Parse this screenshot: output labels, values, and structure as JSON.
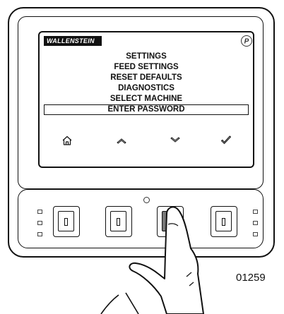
{
  "brand": {
    "name": "WALLENSTEIN"
  },
  "badge": {
    "letter": "P",
    "icon": "pause-p-icon"
  },
  "menu": {
    "items": [
      {
        "label": "SETTINGS",
        "selected": false
      },
      {
        "label": "FEED SETTINGS",
        "selected": false
      },
      {
        "label": "RESET DEFAULTS",
        "selected": false
      },
      {
        "label": "DIAGNOSTICS",
        "selected": false
      },
      {
        "label": "SELECT MACHINE",
        "selected": false
      },
      {
        "label": "ENTER PASSWORD",
        "selected": true
      }
    ]
  },
  "softkeys": [
    {
      "icon": "home-icon"
    },
    {
      "icon": "chevron-up-icon"
    },
    {
      "icon": "chevron-down-icon"
    },
    {
      "icon": "checkmark-icon"
    }
  ],
  "hardware_buttons": [
    {
      "name": "button-1",
      "pressed": false
    },
    {
      "name": "button-2",
      "pressed": false
    },
    {
      "name": "button-3",
      "pressed": true
    },
    {
      "name": "button-4",
      "pressed": false
    }
  ],
  "figure": {
    "number": "01259"
  }
}
